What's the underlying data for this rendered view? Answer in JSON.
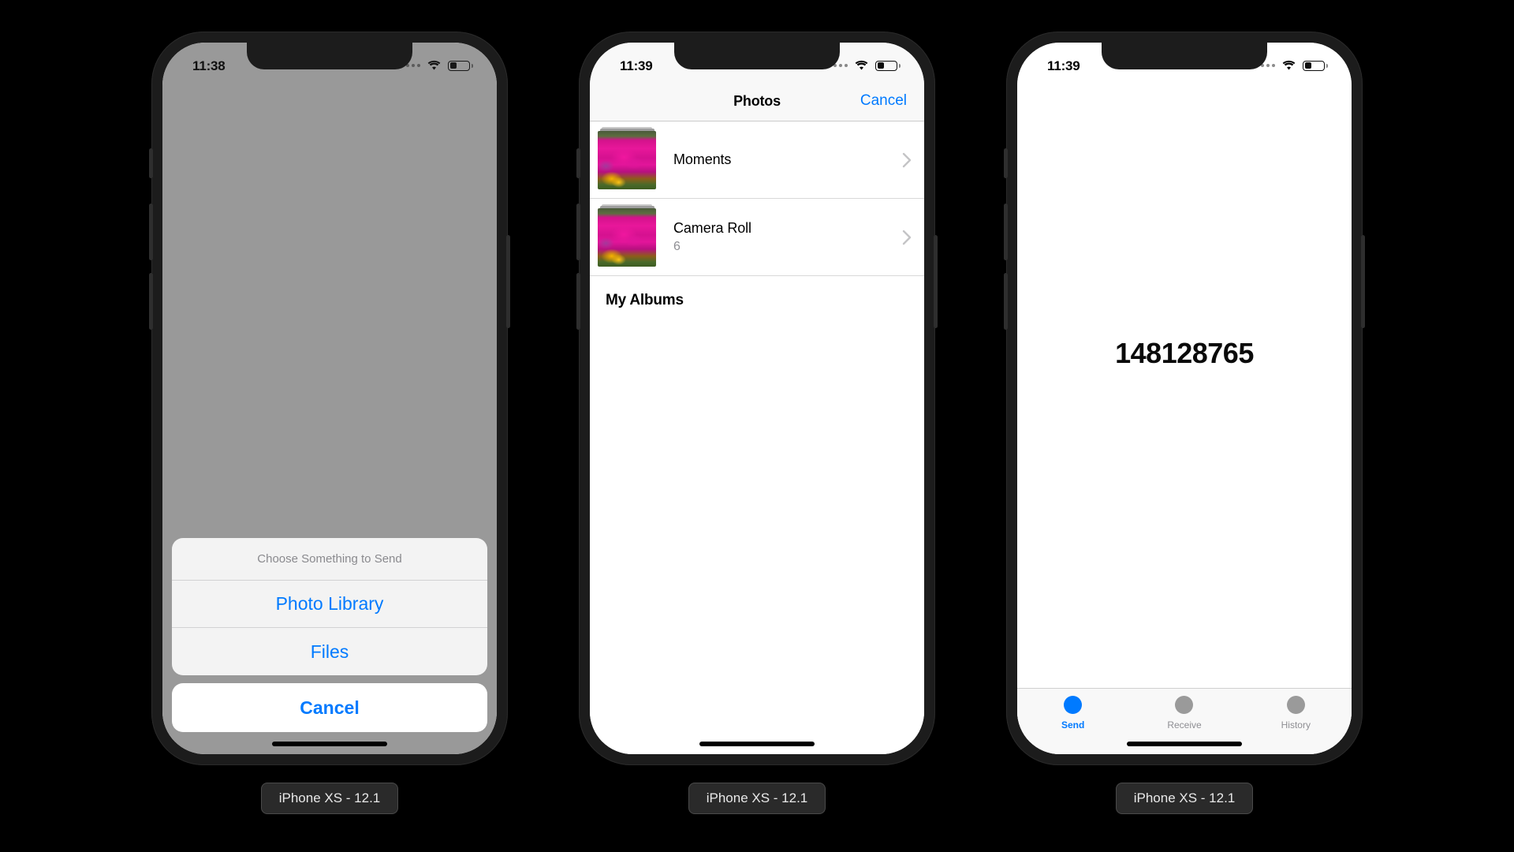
{
  "simulators": [
    {
      "caption": "iPhone XS - 12.1",
      "status": {
        "time": "11:38",
        "wifi": "wifi-icon",
        "battery": "battery-icon",
        "signal": "signal-dots-icon"
      },
      "screen": "action-sheet",
      "action_sheet": {
        "title": "Choose Something to Send",
        "options": [
          {
            "label": "Photo Library"
          },
          {
            "label": "Files"
          }
        ],
        "cancel_label": "Cancel"
      }
    },
    {
      "caption": "iPhone XS - 12.1",
      "status": {
        "time": "11:39",
        "wifi": "wifi-icon",
        "battery": "battery-icon",
        "signal": "signal-dots-icon"
      },
      "screen": "photo-picker",
      "nav": {
        "title": "Photos",
        "action_label": "Cancel"
      },
      "albums": [
        {
          "name": "Moments",
          "count": ""
        },
        {
          "name": "Camera Roll",
          "count": "6"
        }
      ],
      "section_header": "My Albums"
    },
    {
      "caption": "iPhone XS - 12.1",
      "status": {
        "time": "11:39",
        "wifi": "wifi-icon",
        "battery": "battery-icon",
        "signal": "signal-dots-icon"
      },
      "screen": "send",
      "device_code": "148128765",
      "tabs": [
        {
          "label": "Send",
          "active": true
        },
        {
          "label": "Receive",
          "active": false
        },
        {
          "label": "History",
          "active": false
        }
      ]
    }
  ],
  "colors": {
    "accent": "#007aff",
    "dimmed_overlay": "#999999",
    "frame": "#1c1c1c",
    "background": "#000000",
    "secondary_text": "#8e8e93"
  }
}
